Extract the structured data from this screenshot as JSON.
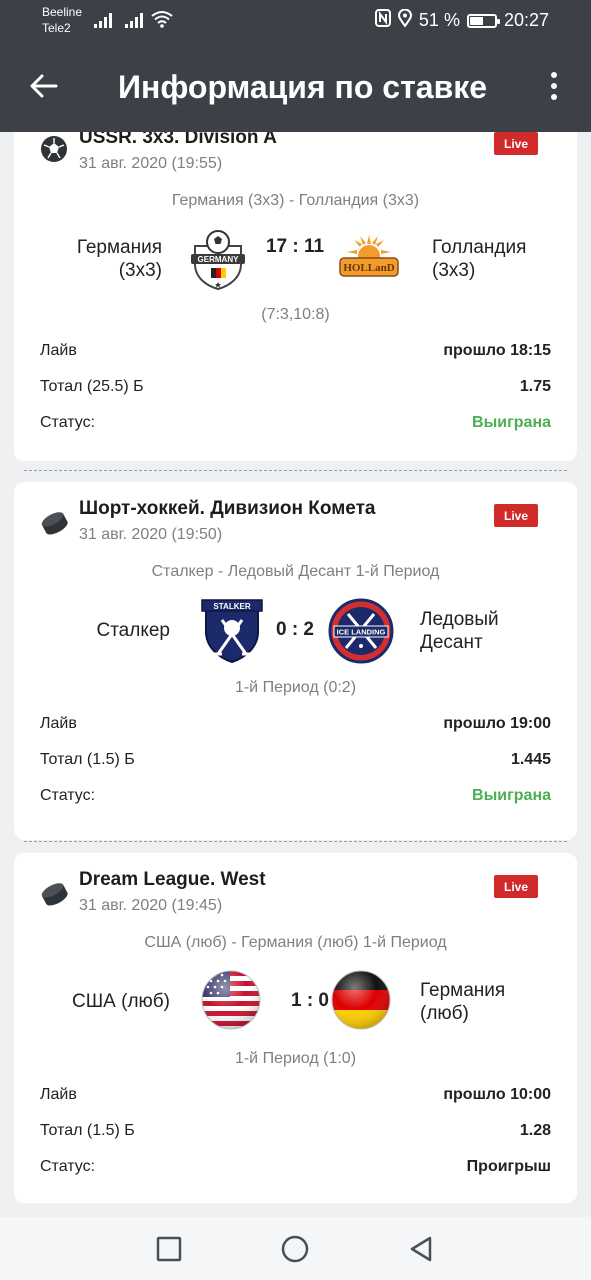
{
  "status_bar": {
    "carrier_1": "Beeline",
    "carrier_2": "Tele2",
    "battery_text": "51 %",
    "battery_level": 0.51,
    "time": "20:27"
  },
  "app_bar": {
    "title": "Информация по ставке",
    "back_icon": "arrow-left-icon",
    "menu_icon": "more-vert-icon"
  },
  "colors": {
    "header_bg": "#3b4147",
    "live_badge": "#d12a2a",
    "won": "#4caf50"
  },
  "bets": [
    {
      "sport_icon": "soccer-ball-icon",
      "league": "USSR. 3x3. Division A",
      "date": "31 авг. 2020 (19:55)",
      "live": "Live",
      "match_title": "Германия (3x3) - Голландия (3x3)",
      "home": "Германия (3x3)",
      "away": "Голландия (3x3)",
      "home_logo": "germany-badge-logo",
      "away_logo": "holland-sun-logo",
      "score": "17 : 11",
      "period": "(7:3,10:8)",
      "rows": [
        {
          "label": "Лайв",
          "value": "прошло 18:15"
        },
        {
          "label": "Тотал (25.5) Б",
          "value": "1.75"
        },
        {
          "label": "Статус:",
          "value": "Выиграна"
        }
      ]
    },
    {
      "sport_icon": "hockey-puck-icon",
      "league": "Шорт-хоккей. Дивизион Комета",
      "date": "31 авг. 2020 (19:50)",
      "live": "Live",
      "match_title": "Сталкер - Ледовый Десант 1-й Период",
      "home": "Сталкер",
      "away": "Ледовый Десант",
      "home_logo": "stalker-shield-logo",
      "away_logo": "ice-landing-logo",
      "logo_text": {
        "stalker": "STALKER",
        "ice": "ICE LANDING"
      },
      "score": "0 : 2",
      "period": "1-й Период (0:2)",
      "rows": [
        {
          "label": "Лайв",
          "value": "прошло 19:00"
        },
        {
          "label": "Тотал (1.5) Б",
          "value": "1.445"
        },
        {
          "label": "Статус:",
          "value": "Выиграна"
        }
      ]
    },
    {
      "sport_icon": "hockey-puck-icon",
      "league": "Dream League. West",
      "date": "31 авг. 2020 (19:45)",
      "live": "Live",
      "match_title": "США (люб) - Германия (люб) 1-й Период",
      "home": "США (люб)",
      "away": "Германия (люб)",
      "home_logo": "usa-flag-ball",
      "away_logo": "germany-flag-ball",
      "score": "1 : 0",
      "period": "1-й Период (1:0)",
      "rows": [
        {
          "label": "Лайв",
          "value": "прошло 10:00"
        },
        {
          "label": "Тотал (1.5) Б",
          "value": "1.28"
        },
        {
          "label": "Статус:",
          "value": "Проигрыш"
        }
      ]
    }
  ],
  "nav_bar": {
    "recents_icon": "square-icon",
    "home_icon": "circle-icon",
    "back_icon": "triangle-back-icon"
  }
}
